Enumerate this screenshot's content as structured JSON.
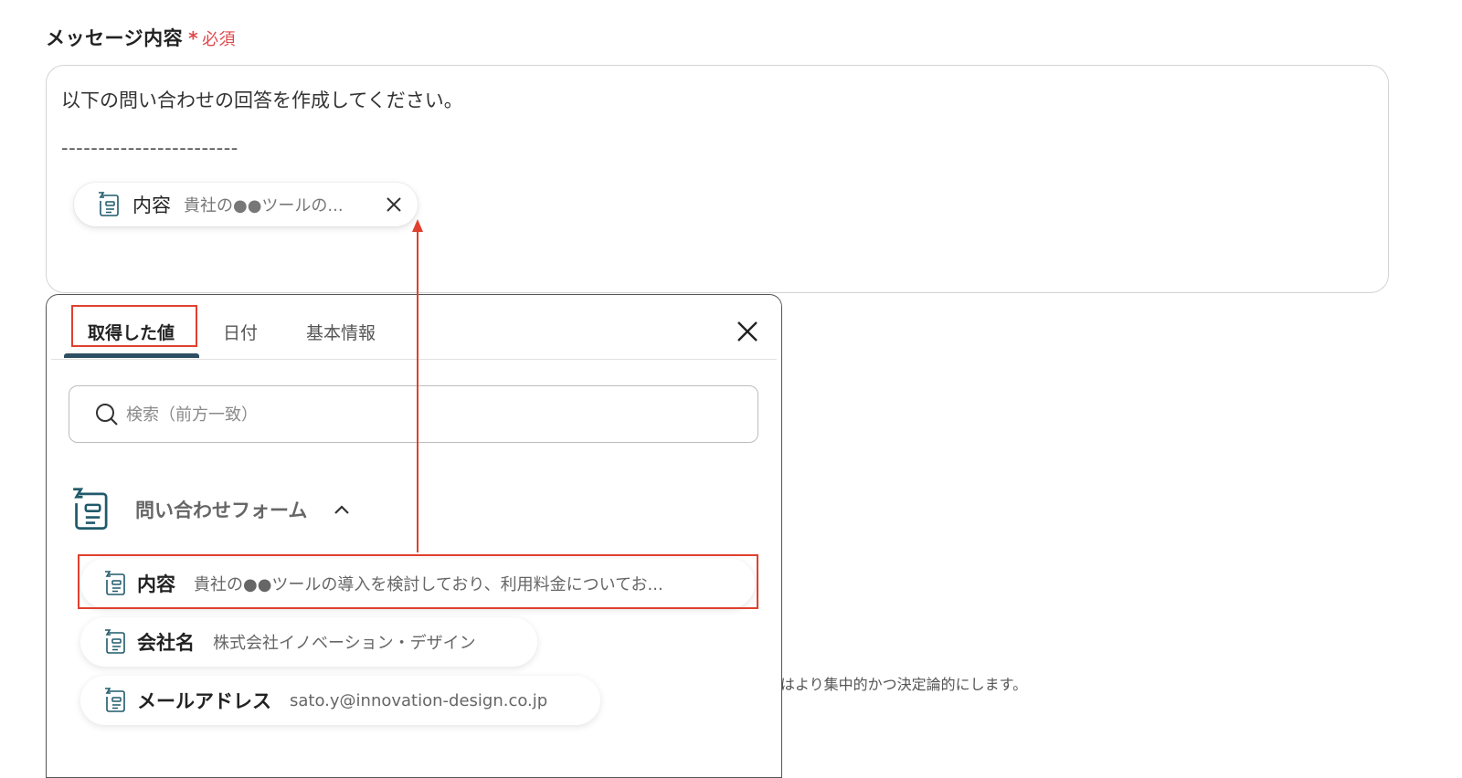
{
  "field": {
    "label": "メッセージ内容",
    "required_star": "*",
    "required_text": "必須"
  },
  "editor": {
    "line1": "以下の問い合わせの回答を作成してください。",
    "line2": "------------------------",
    "chip": {
      "icon": "form-icon",
      "label": "内容",
      "preview": "貴社の●●ツールの..."
    }
  },
  "popup": {
    "tabs": [
      {
        "label": "取得した値",
        "active": true
      },
      {
        "label": "日付",
        "active": false
      },
      {
        "label": "基本情報",
        "active": false
      }
    ],
    "search": {
      "placeholder": "検索（前方一致）",
      "value": ""
    },
    "group": {
      "icon": "form-icon",
      "title": "問い合わせフォーム",
      "expanded": true
    },
    "items": [
      {
        "icon": "form-icon",
        "name": "内容",
        "value": "貴社の●●ツールの導入を検討しており、利用料金についてお..."
      },
      {
        "icon": "form-icon",
        "name": "会社名",
        "value": "株式会社イノベーション・デザイン"
      },
      {
        "icon": "form-icon",
        "name": "メールアドレス",
        "value": "sato.y@innovation-design.co.jp"
      }
    ]
  },
  "background_text": "はより集中的かつ決定論的にします。",
  "colors": {
    "required": "#e0484d",
    "highlight": "#e0402e",
    "tab_underline": "#2e4e63",
    "icon": "#1f5a6b"
  }
}
